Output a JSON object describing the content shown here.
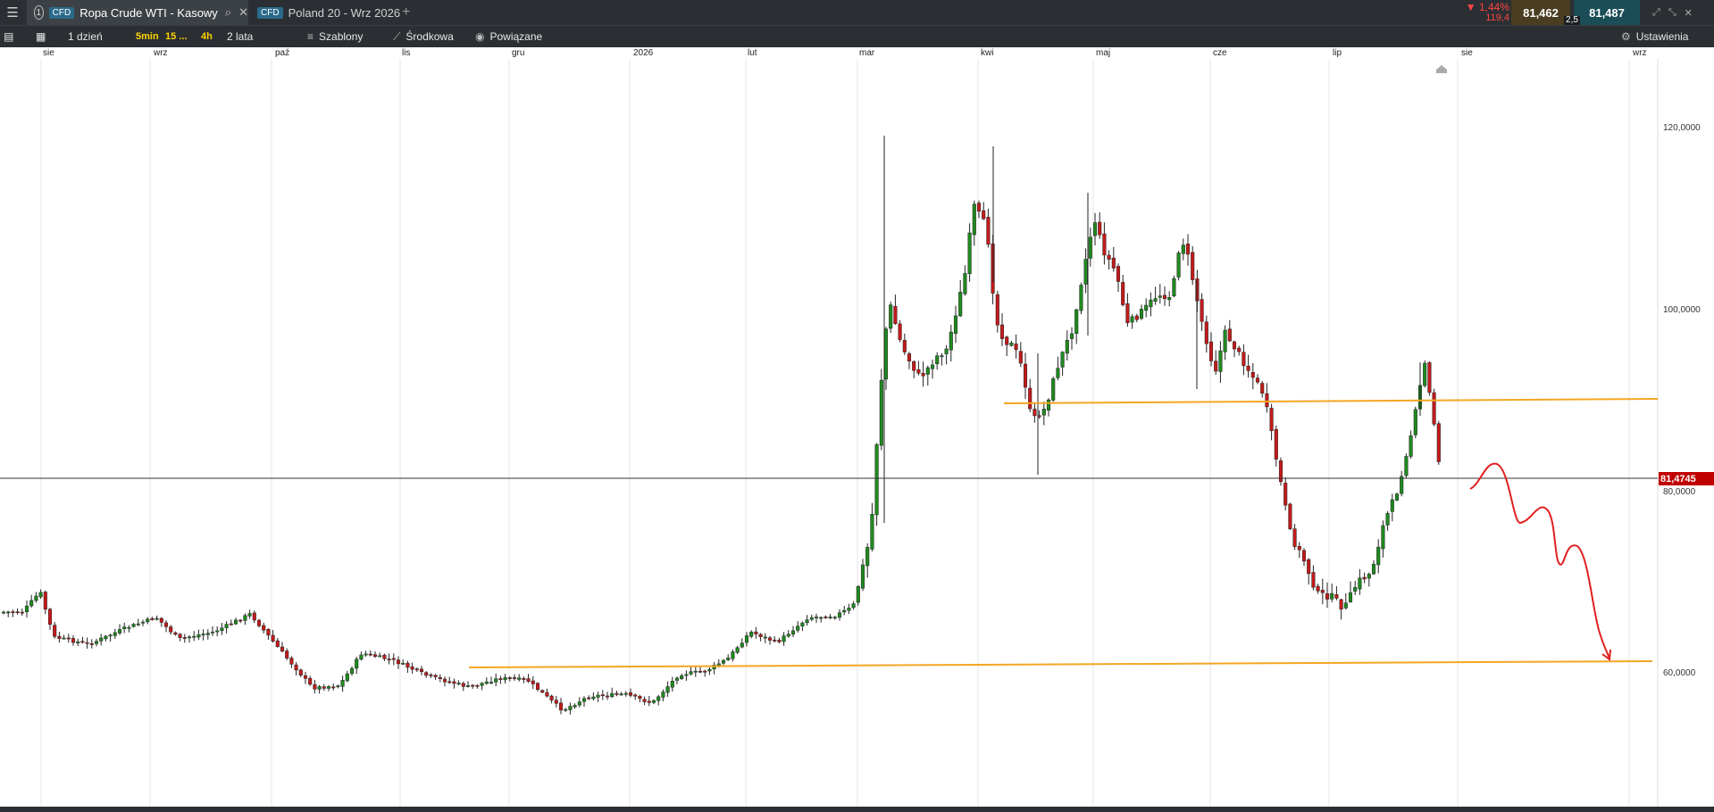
{
  "topbar": {
    "tab_active": {
      "badge": "CFD",
      "title": "Ropa Crude WTI - Kasowy",
      "index": "1"
    },
    "tab_second": {
      "badge": "CFD",
      "title": "Poland 20 - Wrz 2026"
    },
    "change_pct": "▼ 1,44%",
    "change_pts": "119,4",
    "sell_price": "81,462",
    "buy_price": "81,487",
    "spread": "2,5"
  },
  "toolbar": {
    "period": "1 dzień",
    "quick": [
      "5min",
      "15 ...",
      "4h"
    ],
    "range": "2 lata",
    "templates": "Szablony",
    "indicator": "Środkowa",
    "related": "Powiązane",
    "settings": "Ustawienia"
  },
  "time_axis": [
    "sie",
    "wrz",
    "paź",
    "lis",
    "gru",
    "2026",
    "lut",
    "mar",
    "kwi",
    "maj",
    "cze",
    "lip",
    "sie",
    "wrz"
  ],
  "chart_data": {
    "type": "candlestick",
    "y_ticks": [
      "120,0000",
      "100,0000",
      "80,0000",
      "60,0000"
    ],
    "current_price": "81,4745",
    "colors": {
      "up": "#1f8a1f",
      "down": "#c41a1a",
      "support_lines": "#f5a623",
      "forecast": "#e02020",
      "price_tag": "#c00000"
    }
  }
}
